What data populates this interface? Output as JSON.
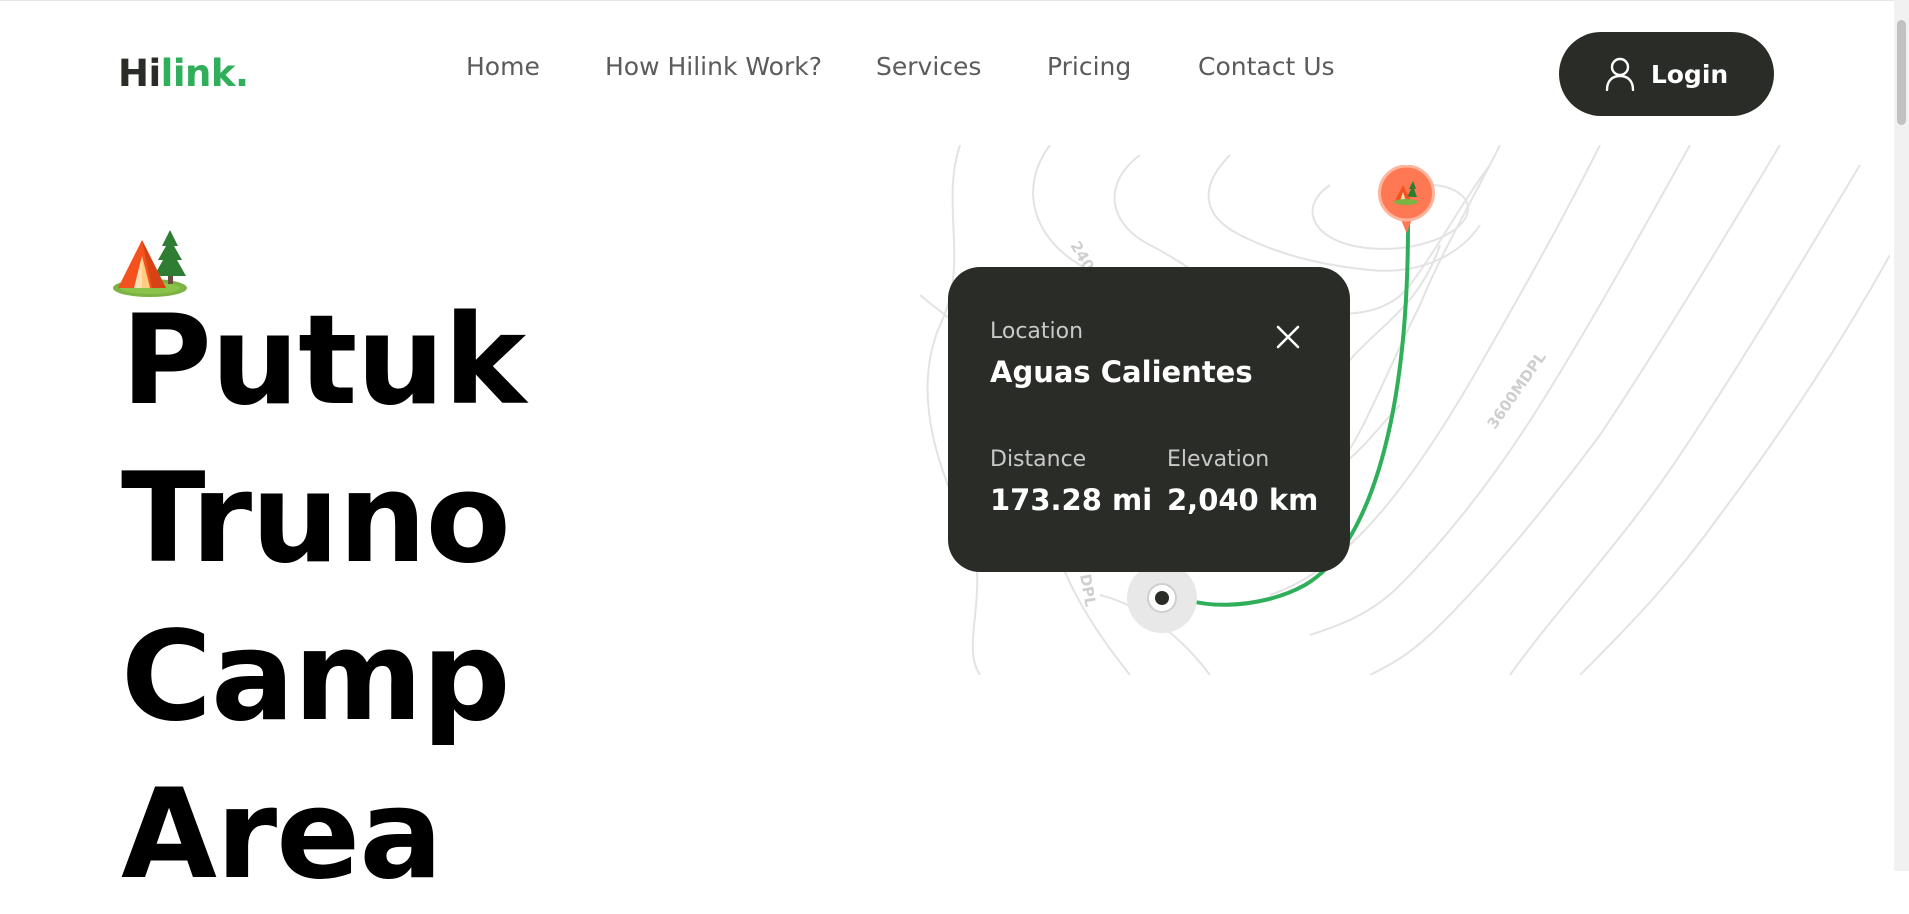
{
  "brand": {
    "logo_prefix": "Hi",
    "logo_suffix": "link."
  },
  "nav": {
    "items": [
      {
        "label": "Home"
      },
      {
        "label": "How Hilink Work?"
      },
      {
        "label": "Services"
      },
      {
        "label": "Pricing"
      },
      {
        "label": "Contact Us"
      }
    ],
    "login_label": "Login"
  },
  "hero": {
    "title_lines": [
      "Putuk",
      "Truno",
      "Camp",
      "Area"
    ]
  },
  "map": {
    "contour_labels": [
      "240",
      "3600MDPL",
      "DPL"
    ]
  },
  "location_card": {
    "location_label": "Location",
    "location_value": "Aguas Calientes",
    "distance_label": "Distance",
    "distance_value": "173.28 mi",
    "elevation_label": "Elevation",
    "elevation_value": "2,040 km"
  },
  "icons": {
    "camp": "camping-tent-icon",
    "user": "user-icon",
    "close": "close-icon",
    "pin": "map-pin-icon"
  },
  "colors": {
    "brand_dark": "#292c27",
    "brand_green": "#30af5b",
    "pin_orange": "#fe7853"
  }
}
